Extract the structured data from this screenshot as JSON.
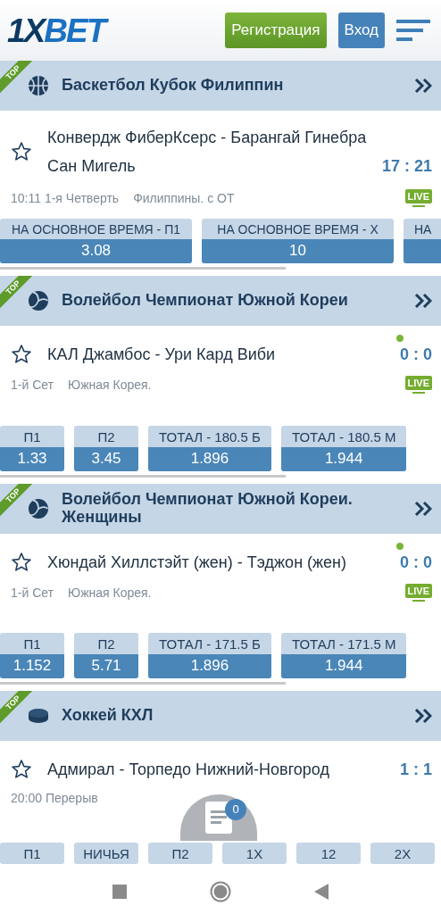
{
  "header": {
    "logo": {
      "part1": "1X",
      "part2": "BET"
    },
    "register_button": "Регистрация",
    "login_button": "Вход"
  },
  "sections": [
    {
      "title": "Баскетбол Кубок Филиппин",
      "kind": "basketball",
      "ribbon": "TOP",
      "match": {
        "teams": "Конвердж ФиберКсерс - Барангай Гинебра Сан Мигель",
        "score": "17 : 21",
        "serving": false,
        "meta": [
          "10:11 1-я Четверть",
          "Филиппины. с ОТ"
        ],
        "live": "LIVE"
      },
      "odds": [
        {
          "kind": "full",
          "label": "НА ОСНОВНОЕ ВРЕМЯ - П1",
          "value": "3.08"
        },
        {
          "kind": "full",
          "label": "НА ОСНОВНОЕ ВРЕМЯ - Х",
          "value": "10"
        },
        {
          "kind": "partial",
          "label": "НА"
        }
      ]
    },
    {
      "title": "Волейбол Чемпионат Южной Кореи",
      "kind": "volleyball",
      "ribbon": "TOP",
      "match": {
        "teams": "КАЛ Джамбос - Ури Кард Виби",
        "score": "0 : 0",
        "serving": true,
        "meta": [
          "1-й Сет",
          "Южная Корея."
        ],
        "live": "LIVE"
      },
      "odds": [
        {
          "kind": "full",
          "label": "П1",
          "value": "1.33"
        },
        {
          "kind": "full",
          "label": "П2",
          "value": "3.45"
        },
        {
          "kind": "full",
          "label": "ТОТАЛ - 180.5 Б",
          "value": "1.896"
        },
        {
          "kind": "full",
          "label": "ТОТАЛ - 180.5 М",
          "value": "1.944"
        }
      ]
    },
    {
      "title": "Волейбол Чемпионат Южной Кореи. Женщины",
      "kind": "volleyball",
      "ribbon": "TOP",
      "match": {
        "teams": "Хюндай Хиллстэйт (жен) - Тэджон (жен)",
        "score": "0 : 0",
        "serving": true,
        "meta": [
          "1-й Сет",
          "Южная Корея."
        ],
        "live": "LIVE"
      },
      "odds": [
        {
          "kind": "full",
          "label": "П1",
          "value": "1.152"
        },
        {
          "kind": "full",
          "label": "П2",
          "value": "5.71"
        },
        {
          "kind": "full",
          "label": "ТОТАЛ - 171.5 Б",
          "value": "1.896"
        },
        {
          "kind": "full",
          "label": "ТОТАЛ - 171.5 М",
          "value": "1.944"
        }
      ]
    },
    {
      "title": "Хоккей КХЛ",
      "kind": "hockey",
      "ribbon": "TOP",
      "match": {
        "teams": "Адмирал - Торпедо Нижний-Новгород",
        "score": "1 : 1",
        "serving": false,
        "meta": [
          "20:00 Перерыв"
        ]
      },
      "odds": [
        {
          "kind": "label",
          "label": "П1"
        },
        {
          "kind": "label",
          "label": "НИЧЬЯ"
        },
        {
          "kind": "label",
          "label": "П2"
        },
        {
          "kind": "label",
          "label": "1Х"
        },
        {
          "kind": "label",
          "label": "12"
        },
        {
          "kind": "label",
          "label": "2Х"
        }
      ]
    }
  ],
  "bet_slip": {
    "count": "0"
  }
}
